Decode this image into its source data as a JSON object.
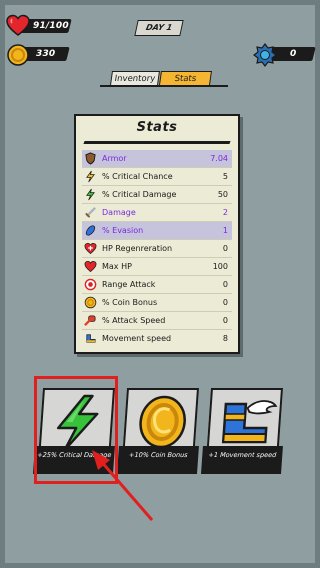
{
  "hud": {
    "health": "91/100",
    "coins": "330",
    "day": "DAY 1",
    "gems": "0"
  },
  "tabs": [
    {
      "label": "Inventory",
      "active": false
    },
    {
      "label": "Stats",
      "active": true
    }
  ],
  "stats_panel": {
    "title": "Stats",
    "rows": [
      {
        "icon": "armor-icon",
        "label": "Armor",
        "value": "7.04",
        "style": "purple-highlight"
      },
      {
        "icon": "lightning-yellow-icon",
        "label": "% Critical Chance",
        "value": "5",
        "style": "normal"
      },
      {
        "icon": "lightning-green-icon",
        "label": "% Critical Damage",
        "value": "50",
        "style": "normal"
      },
      {
        "icon": "sword-icon",
        "label": "Damage",
        "value": "2",
        "style": "purple"
      },
      {
        "icon": "feather-icon",
        "label": "% Evasion",
        "value": "1",
        "style": "blue-highlight"
      },
      {
        "icon": "heart-plus-icon",
        "label": "HP Regenreration",
        "value": "0",
        "style": "normal"
      },
      {
        "icon": "heart-icon",
        "label": "Max HP",
        "value": "100",
        "style": "normal"
      },
      {
        "icon": "target-icon",
        "label": "Range Attack",
        "value": "0",
        "style": "normal"
      },
      {
        "icon": "coin-icon",
        "label": "% Coin Bonus",
        "value": "0",
        "style": "normal"
      },
      {
        "icon": "fist-icon",
        "label": "% Attack Speed",
        "value": "0",
        "style": "normal"
      },
      {
        "icon": "winged-boot-icon",
        "label": "Movement speed",
        "value": "8",
        "style": "normal"
      }
    ]
  },
  "upgrade_cards": [
    {
      "icon": "green-lightning-icon",
      "caption": "+25% Critical Damage",
      "selected": true
    },
    {
      "icon": "gold-coin-icon",
      "caption": "+10% Coin Bonus",
      "selected": false
    },
    {
      "icon": "winged-boot-icon",
      "caption": "+1 Movement speed",
      "selected": false
    }
  ],
  "colors": {
    "background": "#8f9fa1",
    "panel": "#ecebd6",
    "accent_tab": "#f4b632",
    "highlight_text": "#7a2ad8",
    "selection": "#e01f1f"
  }
}
